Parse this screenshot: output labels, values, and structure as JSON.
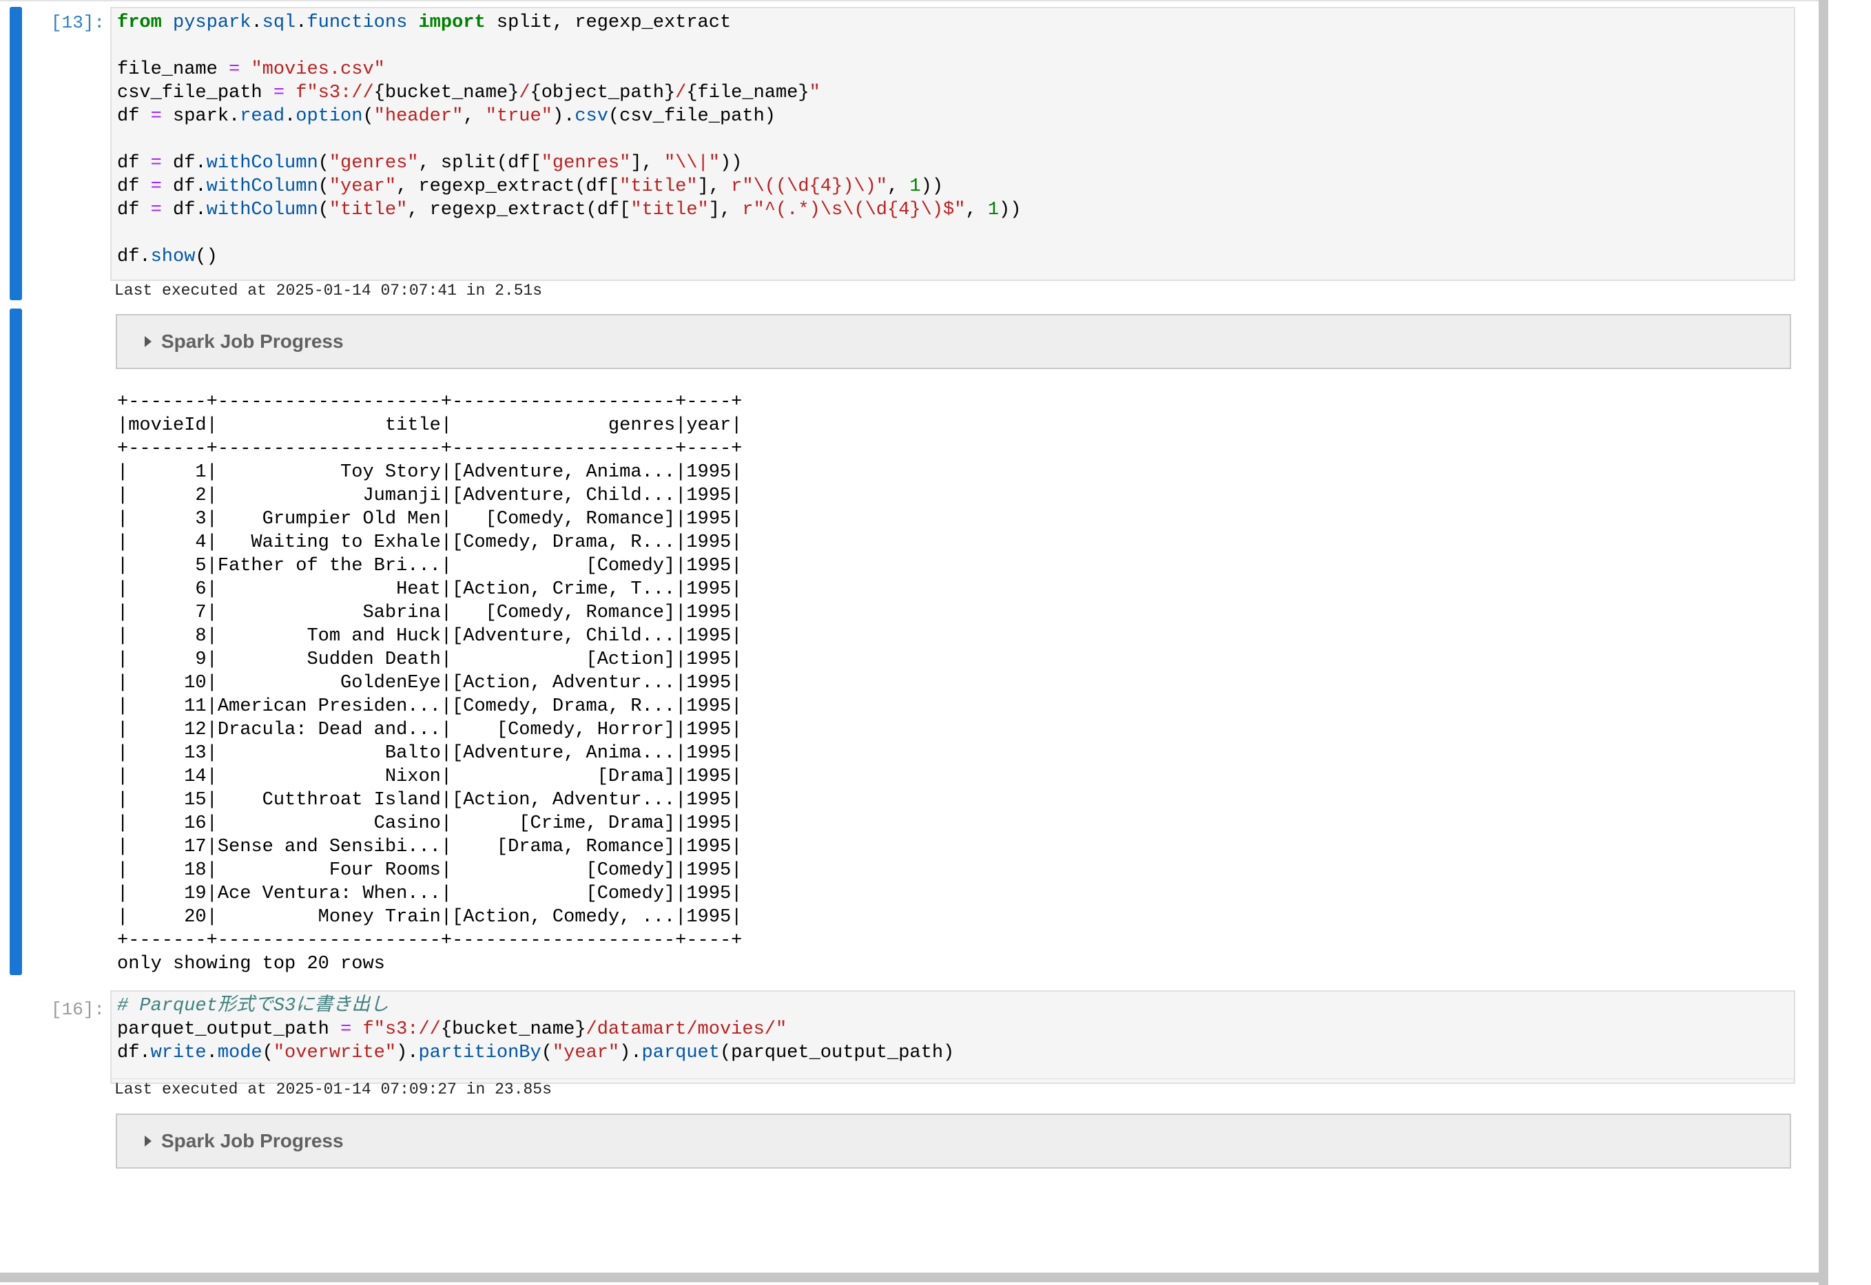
{
  "cells": [
    {
      "prompt": "[13]:",
      "code_lines": [
        [
          [
            "kw",
            "from"
          ],
          [
            "",
            " "
          ],
          [
            "mod",
            "pyspark"
          ],
          [
            "",
            "."
          ],
          [
            "mod",
            "sql"
          ],
          [
            "",
            "."
          ],
          [
            "mod",
            "functions"
          ],
          [
            "",
            " "
          ],
          [
            "kw",
            "import"
          ],
          [
            "",
            " split, regexp_extract"
          ]
        ],
        [],
        [
          [
            "",
            "file_name "
          ],
          [
            "op",
            "="
          ],
          [
            "",
            " "
          ],
          [
            "st",
            "\"movies.csv\""
          ]
        ],
        [
          [
            "",
            "csv_file_path "
          ],
          [
            "op",
            "="
          ],
          [
            "",
            " "
          ],
          [
            "st",
            "f\"s3://"
          ],
          [
            "",
            "{bucket_name}"
          ],
          [
            "st",
            "/"
          ],
          [
            "",
            "{object_path}"
          ],
          [
            "st",
            "/"
          ],
          [
            "",
            "{file_name}"
          ],
          [
            "st",
            "\""
          ]
        ],
        [
          [
            "",
            "df "
          ],
          [
            "op",
            "="
          ],
          [
            "",
            " spark."
          ],
          [
            "fn",
            "read"
          ],
          [
            "",
            "."
          ],
          [
            "fn",
            "option"
          ],
          [
            "",
            "("
          ],
          [
            "st",
            "\"header\""
          ],
          [
            "",
            ", "
          ],
          [
            "st",
            "\"true\""
          ],
          [
            "",
            ")."
          ],
          [
            "fn",
            "csv"
          ],
          [
            "",
            "(csv_file_path)"
          ]
        ],
        [],
        [
          [
            "",
            "df "
          ],
          [
            "op",
            "="
          ],
          [
            "",
            " df."
          ],
          [
            "fn",
            "withColumn"
          ],
          [
            "",
            "("
          ],
          [
            "st",
            "\"genres\""
          ],
          [
            "",
            ", split(df["
          ],
          [
            "st",
            "\"genres\""
          ],
          [
            "",
            "], "
          ],
          [
            "st",
            "\"\\\\|\""
          ],
          [
            "",
            "))"
          ]
        ],
        [
          [
            "",
            "df "
          ],
          [
            "op",
            "="
          ],
          [
            "",
            " df."
          ],
          [
            "fn",
            "withColumn"
          ],
          [
            "",
            "("
          ],
          [
            "st",
            "\"year\""
          ],
          [
            "",
            ", regexp_extract(df["
          ],
          [
            "st",
            "\"title\""
          ],
          [
            "",
            "], "
          ],
          [
            "st",
            "r\"\\((\\d{4})\\)\""
          ],
          [
            "",
            ", "
          ],
          [
            "nm",
            "1"
          ],
          [
            "",
            "))"
          ]
        ],
        [
          [
            "",
            "df "
          ],
          [
            "op",
            "="
          ],
          [
            "",
            " df."
          ],
          [
            "fn",
            "withColumn"
          ],
          [
            "",
            "("
          ],
          [
            "st",
            "\"title\""
          ],
          [
            "",
            ", regexp_extract(df["
          ],
          [
            "st",
            "\"title\""
          ],
          [
            "",
            "], "
          ],
          [
            "st",
            "r\"^(.*)\\s\\(\\d{4}\\)$\""
          ],
          [
            "",
            ", "
          ],
          [
            "nm",
            "1"
          ],
          [
            "",
            "))"
          ]
        ],
        [],
        [
          [
            "",
            "df."
          ],
          [
            "fn",
            "show"
          ],
          [
            "",
            "()"
          ]
        ]
      ],
      "exec_time": "Last executed at 2025-01-14 07:07:41 in 2.51s",
      "spark_label": "Spark Job Progress",
      "output_lines": [
        "+-------+--------------------+--------------------+----+",
        "|movieId|               title|              genres|year|",
        "+-------+--------------------+--------------------+----+",
        "|      1|           Toy Story|[Adventure, Anima...|1995|",
        "|      2|             Jumanji|[Adventure, Child...|1995|",
        "|      3|    Grumpier Old Men|   [Comedy, Romance]|1995|",
        "|      4|   Waiting to Exhale|[Comedy, Drama, R...|1995|",
        "|      5|Father of the Bri...|            [Comedy]|1995|",
        "|      6|                Heat|[Action, Crime, T...|1995|",
        "|      7|             Sabrina|   [Comedy, Romance]|1995|",
        "|      8|        Tom and Huck|[Adventure, Child...|1995|",
        "|      9|        Sudden Death|            [Action]|1995|",
        "|     10|           GoldenEye|[Action, Adventur...|1995|",
        "|     11|American Presiden...|[Comedy, Drama, R...|1995|",
        "|     12|Dracula: Dead and...|    [Comedy, Horror]|1995|",
        "|     13|               Balto|[Adventure, Anima...|1995|",
        "|     14|               Nixon|             [Drama]|1995|",
        "|     15|    Cutthroat Island|[Action, Adventur...|1995|",
        "|     16|              Casino|      [Crime, Drama]|1995|",
        "|     17|Sense and Sensibi...|    [Drama, Romance]|1995|",
        "|     18|          Four Rooms|            [Comedy]|1995|",
        "|     19|Ace Ventura: When...|            [Comedy]|1995|",
        "|     20|         Money Train|[Action, Comedy, ...|1995|",
        "+-------+--------------------+--------------------+----+",
        "only showing top 20 rows"
      ]
    },
    {
      "prompt": "[16]:",
      "code_lines": [
        [
          [
            "cm",
            "# Parquet形式でS3に書き出し"
          ]
        ],
        [
          [
            "",
            "parquet_output_path "
          ],
          [
            "op",
            "="
          ],
          [
            "",
            " "
          ],
          [
            "st",
            "f\"s3://"
          ],
          [
            "",
            "{bucket_name}"
          ],
          [
            "st",
            "/datamart/movies/\""
          ]
        ],
        [
          [
            "",
            "df."
          ],
          [
            "fn",
            "write"
          ],
          [
            "",
            "."
          ],
          [
            "fn",
            "mode"
          ],
          [
            "",
            "("
          ],
          [
            "st",
            "\"overwrite\""
          ],
          [
            "",
            ")."
          ],
          [
            "fn",
            "partitionBy"
          ],
          [
            "",
            "("
          ],
          [
            "st",
            "\"year\""
          ],
          [
            "",
            ")."
          ],
          [
            "fn",
            "parquet"
          ],
          [
            "",
            "(parquet_output_path)"
          ]
        ]
      ],
      "exec_time": "Last executed at 2025-01-14 07:09:27 in 23.85s",
      "spark_label": "Spark Job Progress"
    }
  ]
}
